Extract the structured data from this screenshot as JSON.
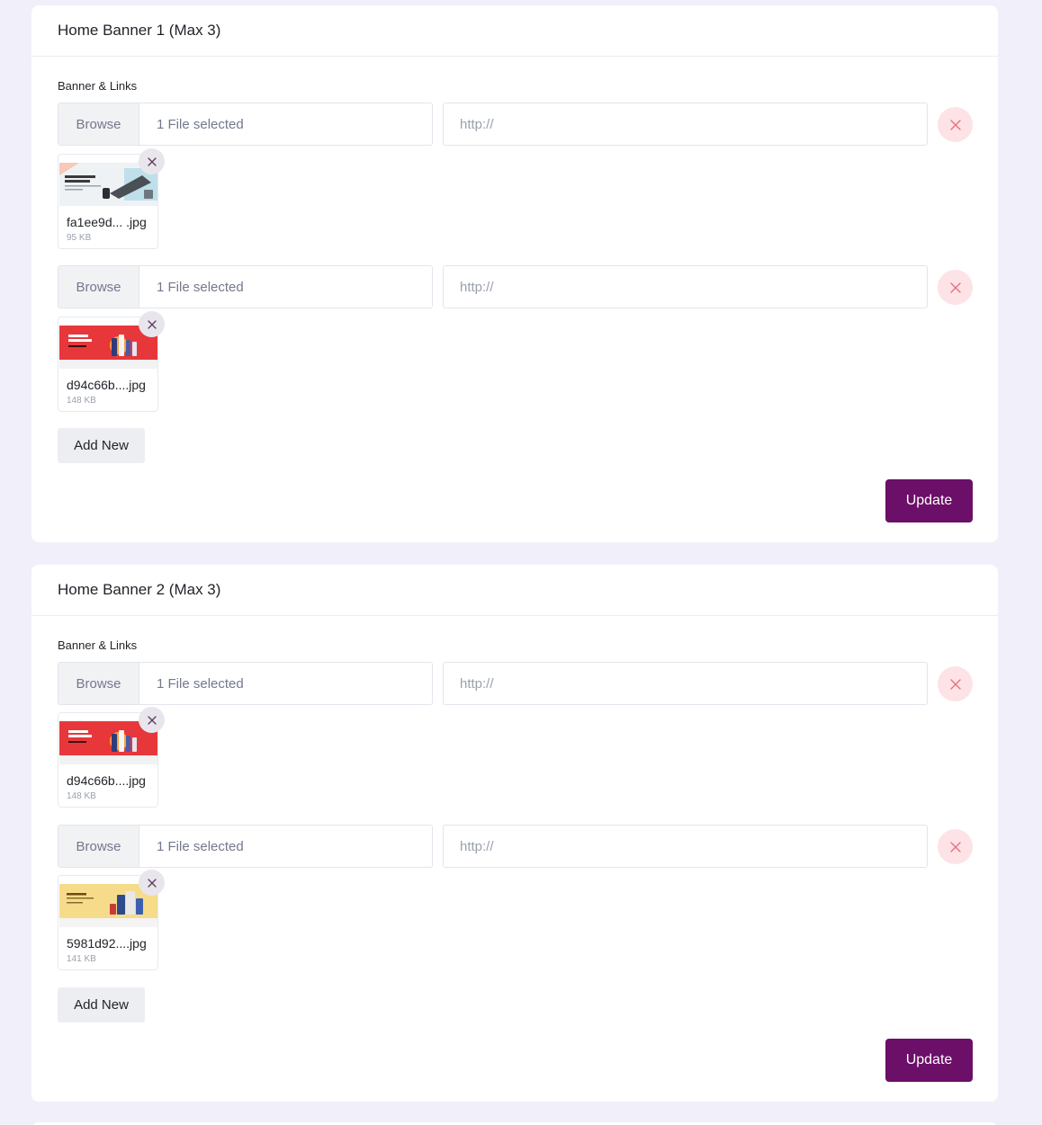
{
  "colors": {
    "page_background": "#f1eff9",
    "primary": "#6b0f68",
    "danger_soft": "#fde2e6",
    "danger_icon": "#e9707f"
  },
  "sections": [
    {
      "title": "Home Banner 1 (Max 3)",
      "field_label": "Banner & Links",
      "rows": [
        {
          "browse_label": "Browse",
          "file_status": "1 File selected",
          "url_value": "",
          "url_placeholder": "http://",
          "remove_icon": "close-icon",
          "file": {
            "name": "fa1ee9d... .jpg",
            "size": "95 KB",
            "thumbnail": "essential-gadgets-banner"
          }
        },
        {
          "browse_label": "Browse",
          "file_status": "1 File selected",
          "url_value": "",
          "url_placeholder": "http://",
          "remove_icon": "close-icon",
          "file": {
            "name": "d94c66b....jpg",
            "size": "148 KB",
            "thumbnail": "beauty-sunshine-banner"
          }
        }
      ],
      "add_new_label": "Add New",
      "update_label": "Update"
    },
    {
      "title": "Home Banner 2 (Max 3)",
      "field_label": "Banner & Links",
      "rows": [
        {
          "browse_label": "Browse",
          "file_status": "1 File selected",
          "url_value": "",
          "url_placeholder": "http://",
          "remove_icon": "close-icon",
          "file": {
            "name": "d94c66b....jpg",
            "size": "148 KB",
            "thumbnail": "beauty-sunshine-banner"
          }
        },
        {
          "browse_label": "Browse",
          "file_status": "1 File selected",
          "url_value": "",
          "url_placeholder": "http://",
          "remove_icon": "close-icon",
          "file": {
            "name": "5981d92....jpg",
            "size": "141 KB",
            "thumbnail": "dcc-corner-banner"
          }
        }
      ],
      "add_new_label": "Add New",
      "update_label": "Update"
    }
  ]
}
